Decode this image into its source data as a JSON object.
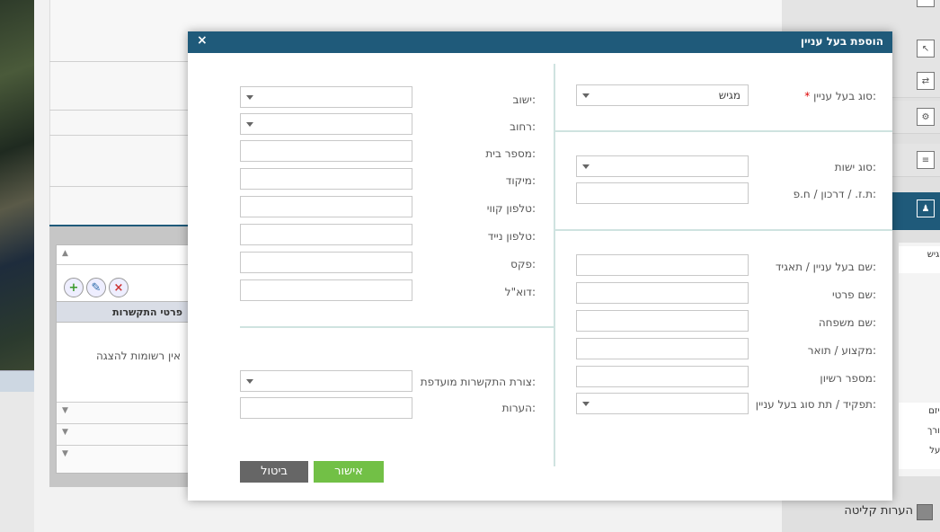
{
  "background": {
    "table": {
      "header": "פרטי התקשרות",
      "empty_text": "אין רשומות להצגה",
      "icons": [
        "add-icon",
        "edit-icon",
        "delete-icon"
      ]
    },
    "side_sub_items": [
      "מגיש",
      "יזם ,",
      "עורך",
      "בעל"
    ],
    "side_bottom_label": "הערות קליטה",
    "side_icon_letters": [
      "ת",
      "ט",
      "ח",
      "ת",
      "ב"
    ]
  },
  "modal": {
    "title": "הוספת בעל עניין",
    "close": "×",
    "right": {
      "stakeholder_type": {
        "label": "סוג בעל עניין:",
        "value": "מגיש",
        "required_mark": "*"
      },
      "entity_type": {
        "label": "סוג ישות:",
        "value": ""
      },
      "id_number": {
        "label": "ת.ז. / דרכון / ח.פ:",
        "value": ""
      },
      "name": {
        "label": "שם בעל עניין / תאגיד:",
        "value": ""
      },
      "first_name": {
        "label": "שם פרטי:",
        "value": ""
      },
      "last_name": {
        "label": "שם משפחה:",
        "value": ""
      },
      "profession": {
        "label": "מקצוע / תואר:",
        "value": ""
      },
      "license": {
        "label": "מספר רשיון:",
        "value": ""
      },
      "role": {
        "label": "תפקיד / תת סוג בעל עניין:",
        "value": ""
      }
    },
    "left": {
      "settlement": {
        "label": "ישוב:",
        "value": ""
      },
      "street": {
        "label": "רחוב:",
        "value": ""
      },
      "house_number": {
        "label": "מספר בית:",
        "value": ""
      },
      "zip": {
        "label": "מיקוד:",
        "value": ""
      },
      "phone": {
        "label": "טלפון קווי:",
        "value": ""
      },
      "mobile": {
        "label": "טלפון נייד:",
        "value": ""
      },
      "fax": {
        "label": "פקס:",
        "value": ""
      },
      "email": {
        "label": "דוא\"ל:",
        "value": ""
      },
      "preferred_contact": {
        "label": "צורת התקשרות מועדפת:",
        "value": ""
      },
      "notes": {
        "label": "הערות:",
        "value": ""
      }
    },
    "buttons": {
      "ok": "אישור",
      "cancel": "ביטול"
    }
  },
  "colors": {
    "header": "#1f5a7a",
    "ok": "#72c046",
    "cancel": "#666666",
    "required": "#dd0000"
  }
}
